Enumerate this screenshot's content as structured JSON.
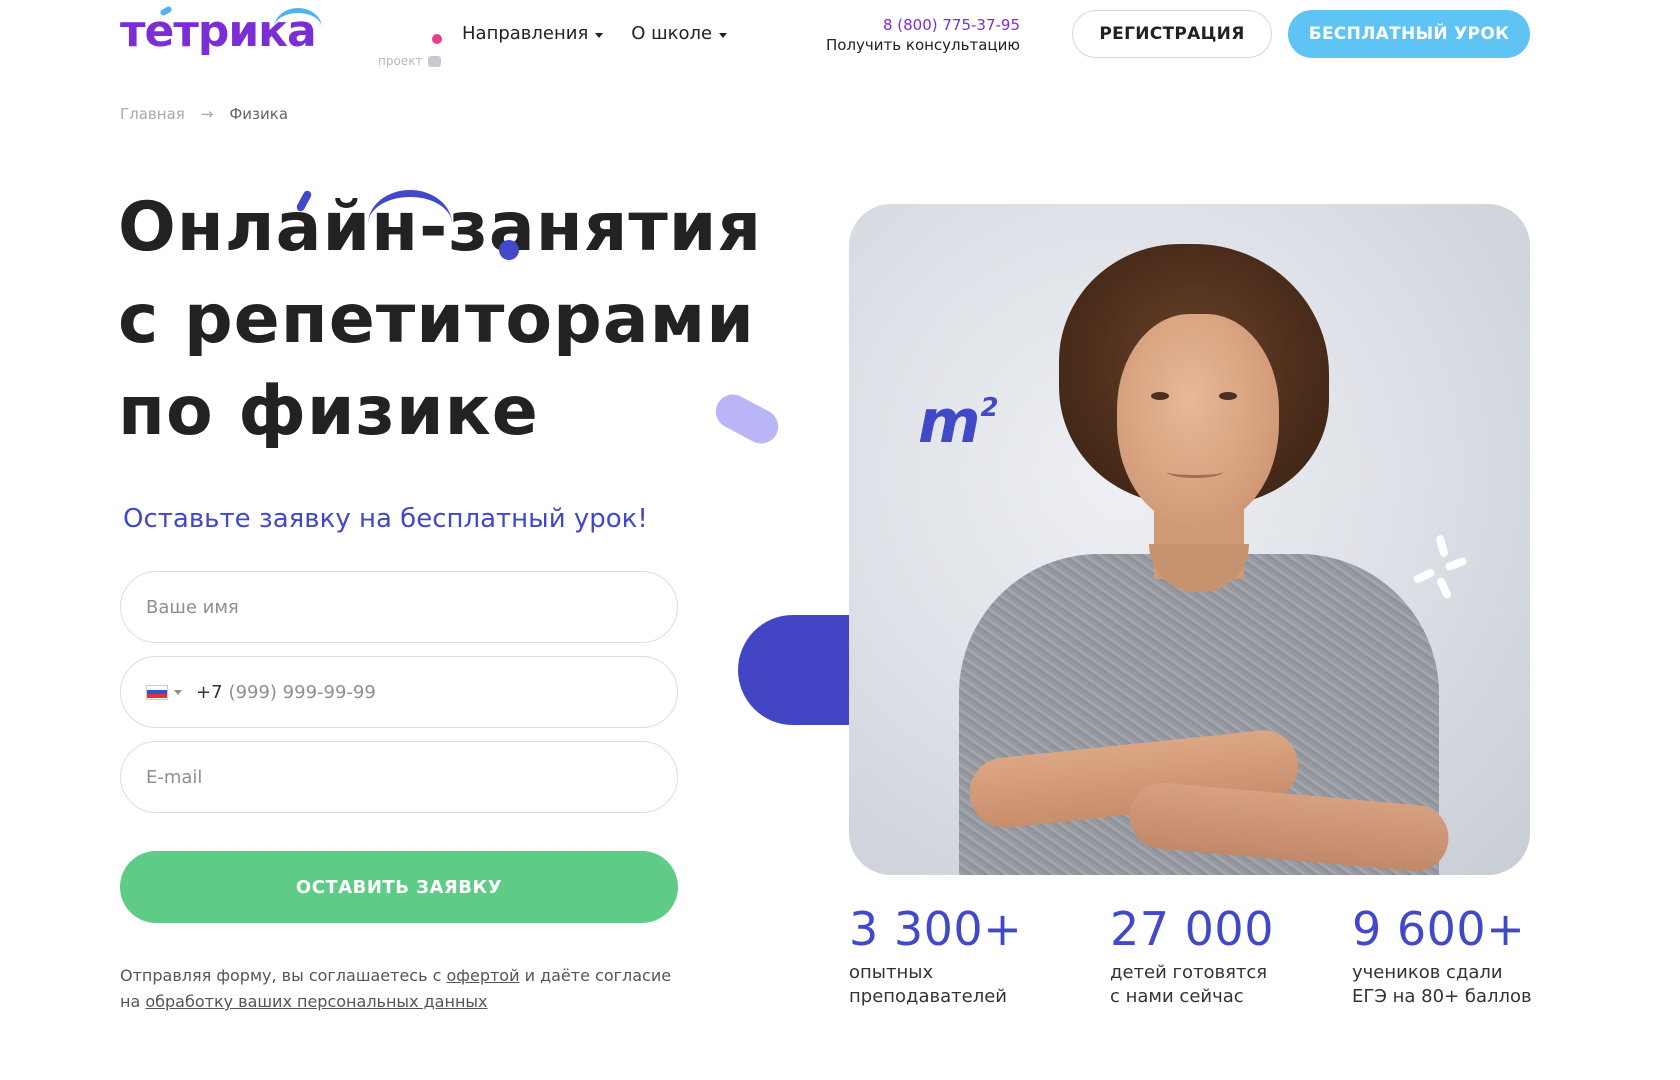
{
  "header": {
    "logo_text": "тетрика",
    "logo_sub": "проект",
    "nav": [
      {
        "label": "Направления"
      },
      {
        "label": "О школе"
      }
    ],
    "phone": "8 (800) 775-37-95",
    "consult": "Получить консультацию",
    "register_label": "РЕГИСТРАЦИЯ",
    "free_lesson_label": "БЕСПЛАТНЫЙ УРОК"
  },
  "breadcrumb": {
    "home": "Главная",
    "separator": "→",
    "current": "Физика"
  },
  "hero": {
    "line1": "Онлайн-занятия",
    "line2": "с репетиторами",
    "line3": "по физике",
    "subhead": "Оставьте заявку на бесплатный урок!"
  },
  "form": {
    "name_placeholder": "Ваше имя",
    "phone_code": "+7",
    "phone_placeholder": "(999) 999-99-99",
    "email_placeholder": "E-mail",
    "submit_label": "ОСТАВИТЬ ЗАЯВКУ",
    "consent_prefix": "Отправляя форму, вы соглашаетесь с",
    "consent_offer": "офертой",
    "consent_middle": "и даёте согласие",
    "consent_on": "на",
    "consent_link": "обработку ваших персональных данных"
  },
  "photo": {
    "formula": "m",
    "formula_sup": "2"
  },
  "stats": [
    {
      "value": "3 300+",
      "label_1": "опытных",
      "label_2": "преподавателей"
    },
    {
      "value": "27 000",
      "label_1": "детей готовятся",
      "label_2": "с нами сейчас"
    },
    {
      "value": "9 600+",
      "label_1": "учеников сдали",
      "label_2": "ЕГЭ на 80+ баллов"
    }
  ],
  "colors": {
    "brand_purple": "#7b2ed6",
    "accent_blue": "#4249c9",
    "cta_green": "#5ecb87",
    "cta_light_blue": "#5fc3f3"
  }
}
